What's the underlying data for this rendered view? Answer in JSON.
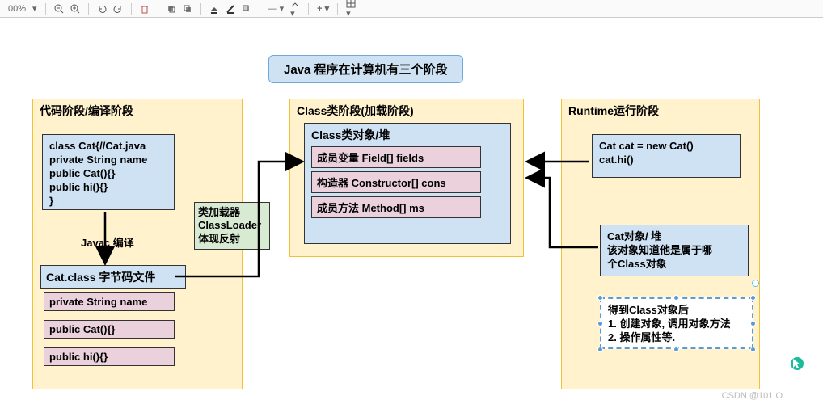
{
  "toolbar": {
    "zoom": "00%",
    "dropdown": "▾"
  },
  "title": "Java 程序在计算机有三个阶段",
  "stage1": {
    "title": "代码阶段/编译阶段",
    "codeBlock": "class Cat{//Cat.java\nprivate String name\npublic Cat(){}\npublic hi(){}\n}",
    "compileLabel": "Javac 编译",
    "bytecodeTitle": "Cat.class 字节码文件",
    "field1": "private String name",
    "field2": "public Cat(){}",
    "field3": "public hi(){}"
  },
  "loader": {
    "l1": "类加载器",
    "l2": "ClassLoader",
    "l3": "体现反射"
  },
  "stage2": {
    "title": "Class类阶段(加载阶段)",
    "heapTitle": "Class类对象/堆",
    "fields": "成员变量 Field[] fields",
    "cons": "构造器 Constructor[] cons",
    "methods": "成员方法 Method[] ms"
  },
  "stage3": {
    "title": "Runtime运行阶段",
    "runCode": "Cat cat = new Cat()\ncat.hi()",
    "heapObj": "Cat对象/ 堆\n该对象知道他是属于哪\n个Class对象",
    "notes": "得到Class对象后\n1. 创建对象, 调用对象方法\n2. 操作属性等."
  },
  "watermark": "CSDN @101.O"
}
